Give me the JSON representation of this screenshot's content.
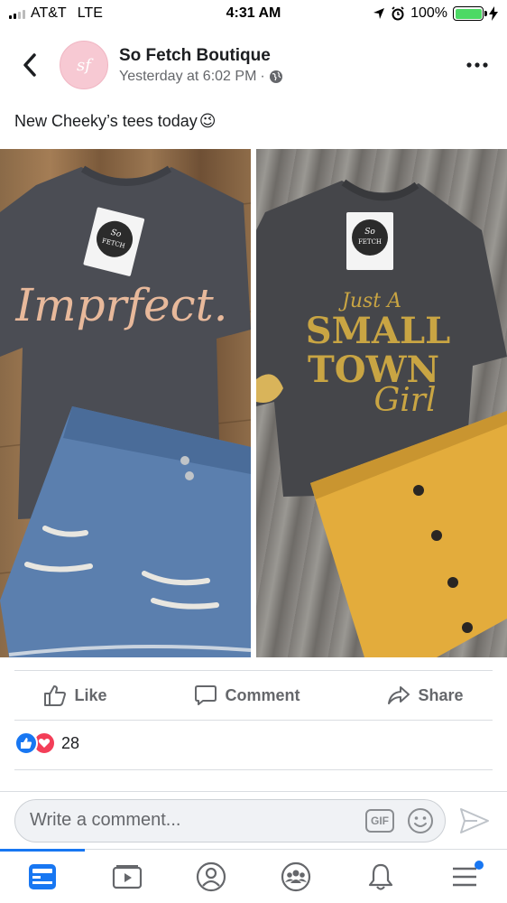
{
  "status_bar": {
    "carrier": "AT&T",
    "network": "LTE",
    "time": "4:31 AM",
    "battery": "100%",
    "battery_level": 1.0
  },
  "post": {
    "page_name": "So Fetch Boutique",
    "avatar_text": "sf",
    "timestamp": "Yesterday at 6:02 PM",
    "separator": "·",
    "privacy_icon": "globe-icon",
    "text": "New Cheeky’s tees today",
    "emoji": "😉",
    "photos": [
      {
        "tag_line1": "So",
        "tag_line2": "FETCH",
        "shirt_text": "Imprfect."
      },
      {
        "tag_line1": "So",
        "tag_line2": "FETCH",
        "shirt_line1": "Just A",
        "shirt_line2": "SMALL",
        "shirt_line3": "TOWN",
        "shirt_line4": "Girl"
      }
    ]
  },
  "actions": {
    "like": "Like",
    "comment": "Comment",
    "share": "Share"
  },
  "reactions": {
    "count": "28",
    "types": [
      "like",
      "love"
    ]
  },
  "comment_box": {
    "placeholder": "Write a comment...",
    "gif_label": "GIF"
  },
  "tab_bar": {
    "tabs": [
      "news-feed",
      "watch",
      "profile",
      "groups",
      "notifications",
      "menu"
    ],
    "active": "news-feed"
  },
  "colors": {
    "accent": "#1877f2",
    "love": "#f33e58",
    "muted": "#65676b"
  }
}
